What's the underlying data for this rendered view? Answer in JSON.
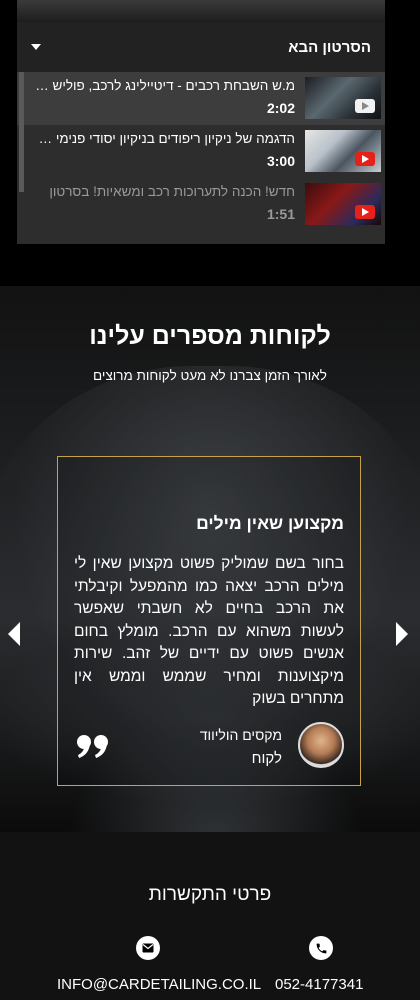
{
  "playlist": {
    "header_title": "הסרטון הבא",
    "items": [
      {
        "title": "מ.ש השבחת רכבים - דיטיילינג לרכב, פוליש ווקס",
        "duration": "2:02",
        "thumb_icon": "youtube-play-icon"
      },
      {
        "title": "הדגמה של ניקיון ריפודים בניקיון יסודי פנימי של רכב",
        "duration": "3:00",
        "thumb_icon": "youtube-play-icon"
      },
      {
        "title": "חדש! הכנה לתערוכות רכב ומשאיות! בסרטון",
        "duration": "1:51",
        "thumb_icon": "youtube-play-icon"
      }
    ]
  },
  "testimonials": {
    "title": "לקוחות מספרים עלינו",
    "subtitle": "לאורך הזמן צברנו לא מעט לקוחות מרוצים",
    "card": {
      "title": "מקצוען שאין מילים",
      "body": "בחור בשם שמוליק פשוט מקצוען שאין לי מילים הרכב יצאה כמו מהמפעל וקיבלתי את הרכב בחיים לא חשבתי שאפשר לעשות משהוא עם הרכב. מומלץ בחום אנשים פשוט עם ידיים של זהב. שירות מיקצוענות ומחיר שממש וממש אין מתחרים בשוק",
      "author_name": "מקסים הוליווד",
      "author_role": "לקוח"
    },
    "accent_color": "#c8a24a"
  },
  "contact": {
    "title": "פרטי התקשרות",
    "email": "INFO@CARDETAILING.CO.IL",
    "phone": "052-4177341",
    "email_icon": "envelope-icon",
    "phone_icon": "phone-icon"
  }
}
